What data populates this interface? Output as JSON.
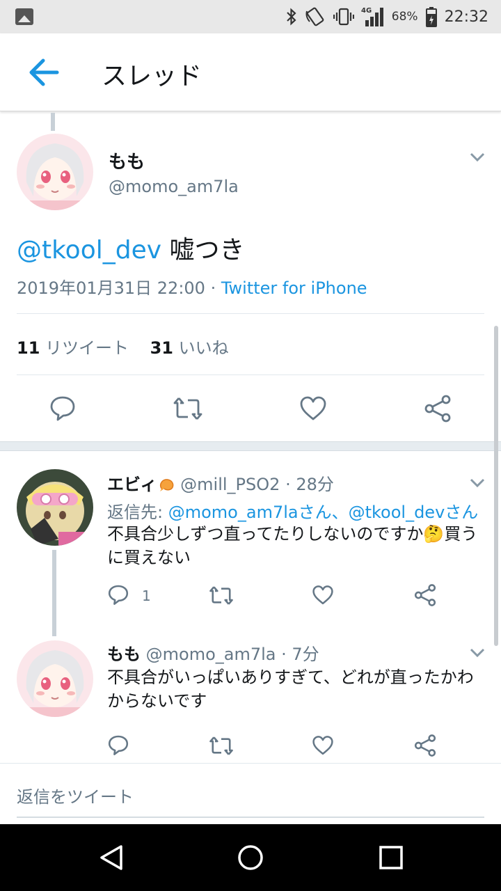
{
  "status_bar": {
    "battery": "68%",
    "network": "4G",
    "time": "22:32",
    "icons": [
      "image-icon",
      "bluetooth-icon",
      "nfc-icon",
      "vibrate-icon",
      "signal-icon",
      "battery-icon"
    ]
  },
  "header": {
    "title": "スレッド",
    "back_icon": "arrow-left-icon",
    "accent": "#1b95e0"
  },
  "main_tweet": {
    "name": "もも",
    "handle": "@momo_am7la",
    "mention": "@tkool_dev",
    "text": " 嘘つき",
    "date": "2019年01月31日 22:00",
    "separator": " · ",
    "source": "Twitter for iPhone",
    "retweet_count": "11",
    "retweet_label": "リツイート",
    "like_count": "31",
    "like_label": "いいね"
  },
  "replies": [
    {
      "name": "エビィ",
      "handle": "@mill_PSO2",
      "time": "· 28分",
      "reply_to_label": "返信先:",
      "reply_to": "@momo_am7laさん、@tkool_devさん",
      "text": "不具合少しずつ直ってたりしないのですか🤔買うに買えない",
      "reply_count": "1"
    },
    {
      "name": "もも",
      "handle": "@momo_am7la",
      "time": "· 7分",
      "text": "不具合がいっぱいありすぎて、どれが直ったかわからないです"
    }
  ],
  "compose": {
    "placeholder": "返信をツイート"
  },
  "colors": {
    "link": "#1b95e0",
    "secondary_text": "#657786",
    "primary_text": "#14171a"
  }
}
